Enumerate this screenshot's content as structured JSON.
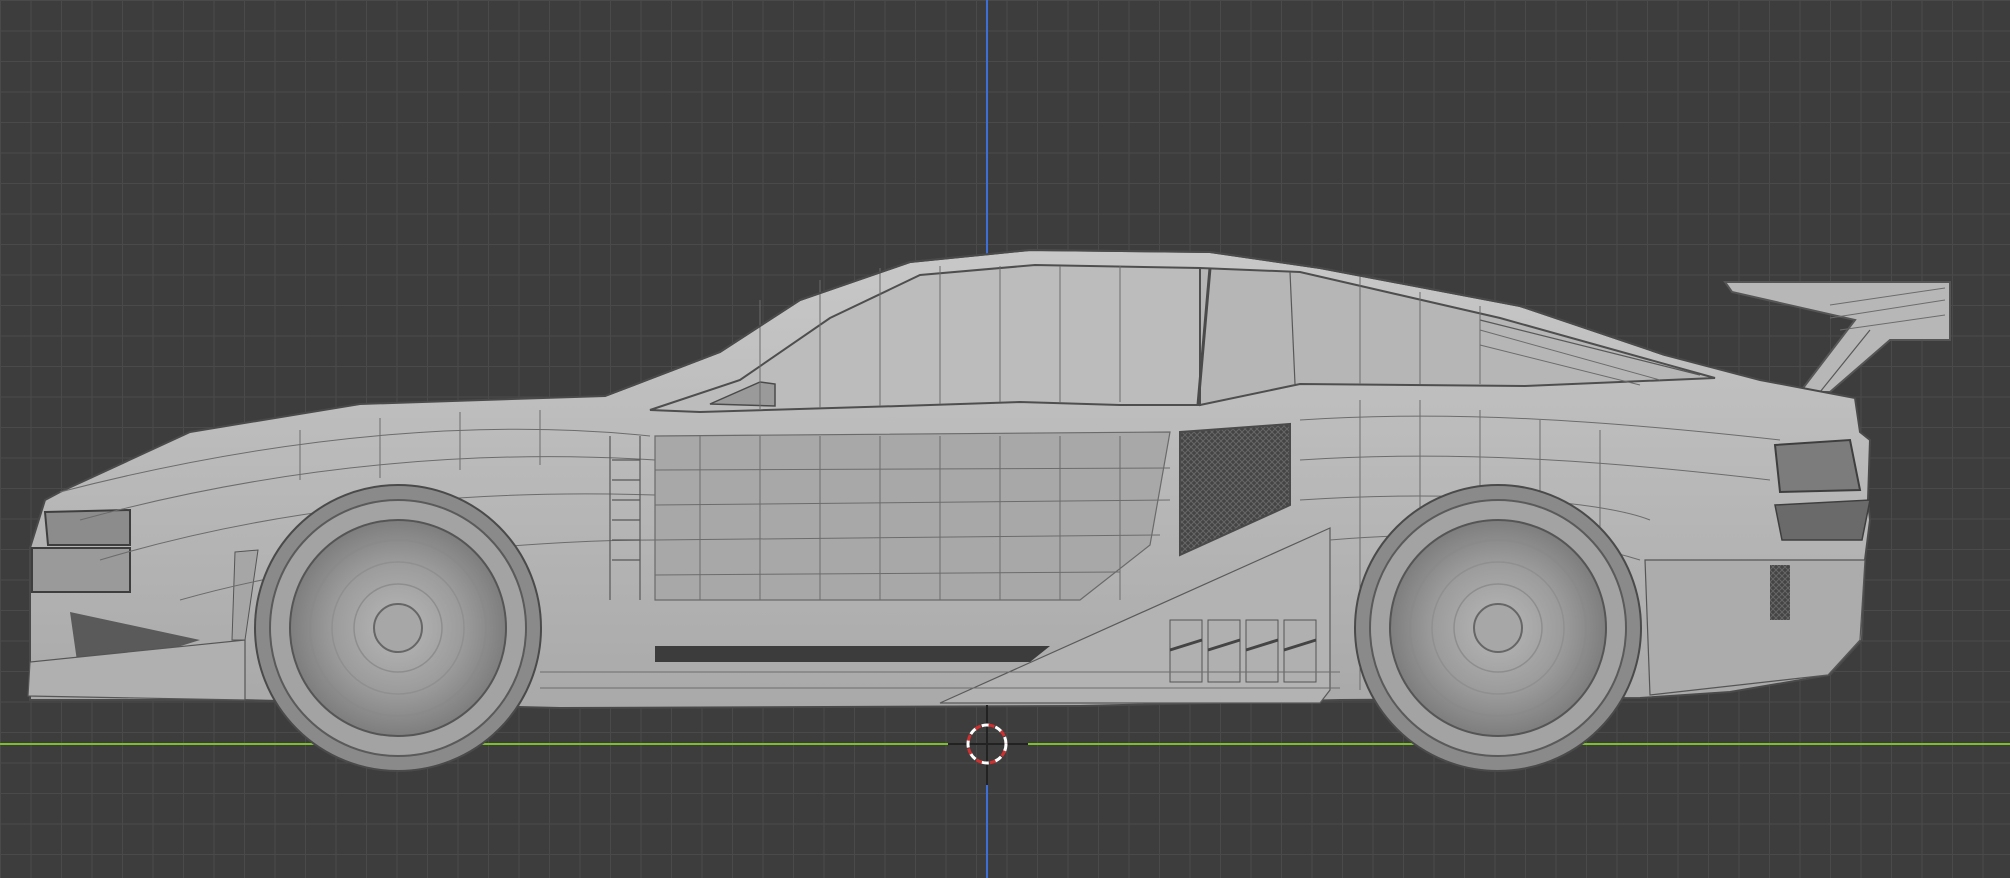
{
  "viewport": {
    "background": "#3d3d3d",
    "grid_color": "#4a4a4a",
    "x_axis_color": "#7bbf2a",
    "z_axis_color": "#3d6fd6",
    "mesh_color": "#bdbdbd",
    "wire_color": "#6c6c6c",
    "cursor_colors": [
      "#ffffff",
      "#d03030"
    ]
  },
  "objects": [
    {
      "name": "car-body",
      "type": "mesh",
      "shading": "solid-wireframe"
    },
    {
      "name": "front-wheel",
      "type": "mesh"
    },
    {
      "name": "rear-wheel",
      "type": "mesh"
    },
    {
      "name": "rear-spoiler",
      "type": "mesh"
    }
  ],
  "icons": {
    "cursor": "3d-cursor-icon"
  }
}
